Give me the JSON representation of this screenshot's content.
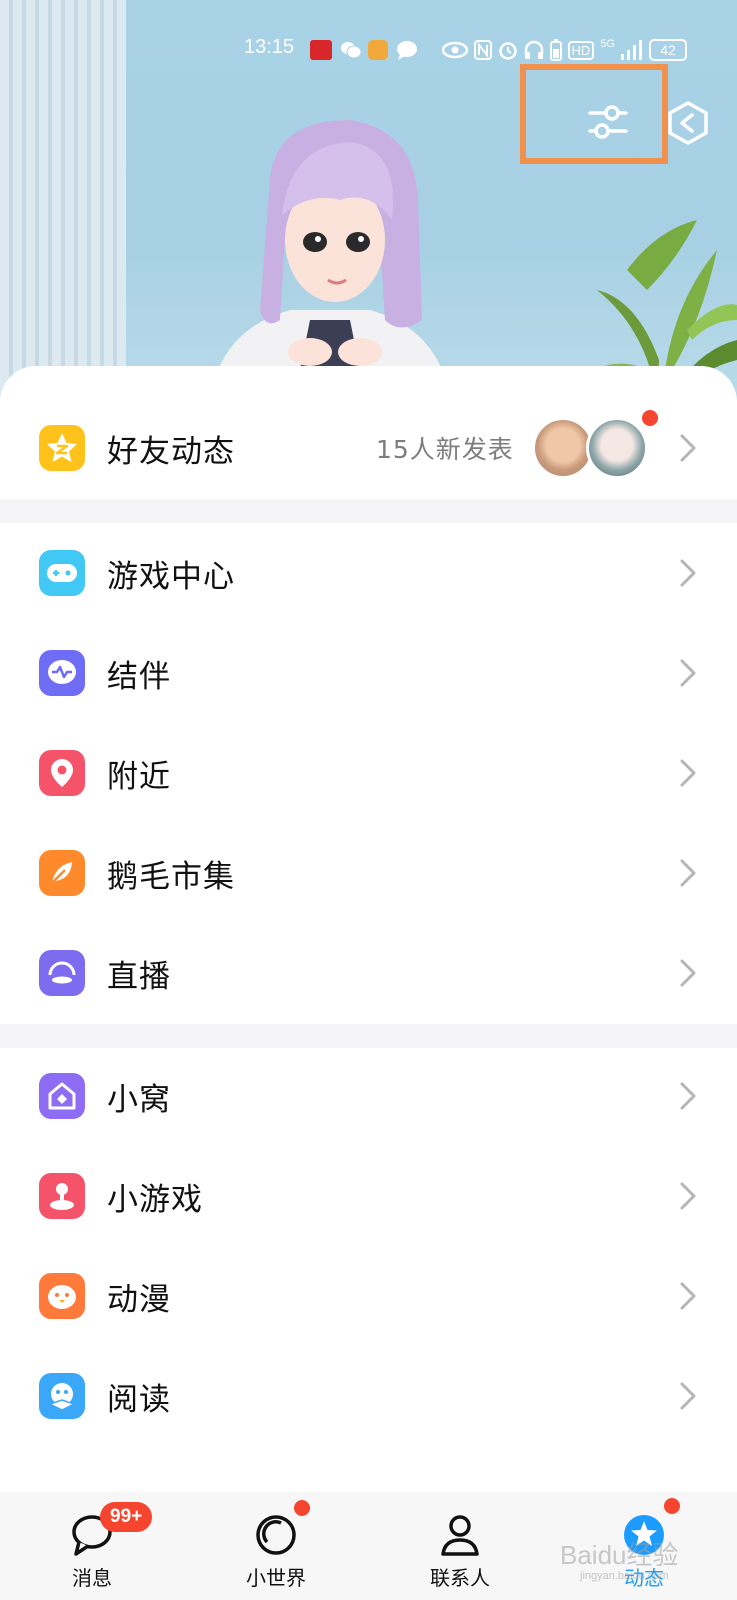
{
  "status_bar": {
    "time": "13:15",
    "network": "5G",
    "hd": "HD",
    "battery": "42"
  },
  "hero": {
    "filter_icon": "sliders-icon",
    "exit_icon": "exit-hexagon-icon"
  },
  "friend_feed": {
    "label": "好友动态",
    "new_posts": "15人新发表",
    "icon": "star-z-icon"
  },
  "menu_group_1": [
    {
      "label": "游戏中心",
      "icon": "gamepad-icon",
      "color": "#41c8f4"
    },
    {
      "label": "结伴",
      "icon": "pulse-chat-icon",
      "color": "#6f6cf5"
    },
    {
      "label": "附近",
      "icon": "location-pin-icon",
      "color": "#f5536a"
    },
    {
      "label": "鹅毛市集",
      "icon": "feather-icon",
      "color": "#ff8a2b"
    },
    {
      "label": "直播",
      "icon": "live-icon",
      "color": "#7d6cf0"
    }
  ],
  "menu_group_2": [
    {
      "label": "小窝",
      "icon": "home-diamond-icon",
      "color": "#8e6df4"
    },
    {
      "label": "小游戏",
      "icon": "joystick-icon",
      "color": "#f5536a"
    },
    {
      "label": "动漫",
      "icon": "penguin-face-icon",
      "color": "#ff7a3a"
    },
    {
      "label": "阅读",
      "icon": "penguin-book-icon",
      "color": "#3aa7f8"
    }
  ],
  "tabbar": {
    "messages": {
      "label": "消息",
      "badge": "99+"
    },
    "world": {
      "label": "小世界"
    },
    "contacts": {
      "label": "联系人"
    },
    "feed": {
      "label": "动态"
    }
  },
  "watermark": {
    "main": "Baidu经验",
    "sub": "jingyan.baidu.com"
  },
  "colors": {
    "highlight": "#f0924e",
    "accent": "#1c9cff",
    "badge": "#f5452f"
  }
}
